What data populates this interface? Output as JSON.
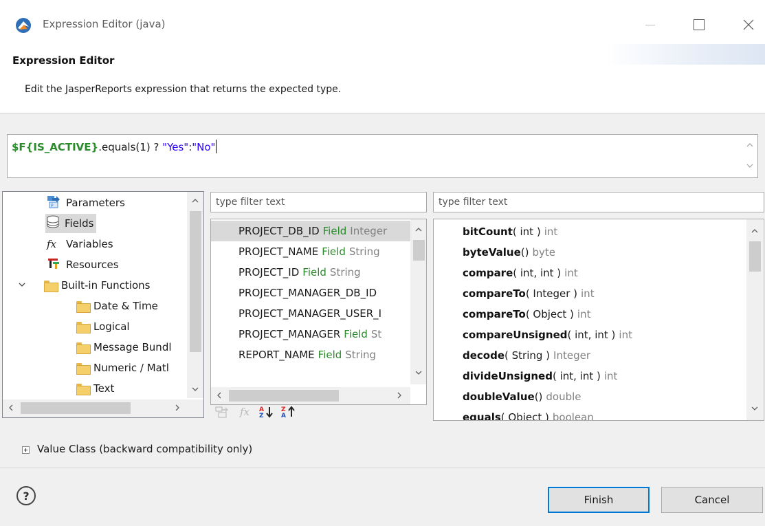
{
  "window": {
    "title": "Expression Editor (java)",
    "icon": "jaspersoft-bird-icon"
  },
  "header": {
    "title": "Expression Editor",
    "description": "Edit the JasperReports expression that returns the expected type."
  },
  "expression": {
    "part1": "$F{IS_ACTIVE}",
    "part2": ".equals(1) ? ",
    "part3": "\"Yes\"",
    "part4": ":",
    "part5": "\"No\""
  },
  "tree": {
    "items": [
      {
        "label": "Parameters",
        "icon": "parameters-icon"
      },
      {
        "label": "Fields",
        "icon": "database-icon",
        "selected": true
      },
      {
        "label": "Variables",
        "icon": "fx-icon"
      },
      {
        "label": "Resources",
        "icon": "resources-icon"
      },
      {
        "label": "Built-in Functions",
        "icon": "folder-icon",
        "expanded": true
      },
      {
        "label": "Date & Time",
        "icon": "folder-icon"
      },
      {
        "label": "Logical",
        "icon": "folder-icon"
      },
      {
        "label": "Message Bundl",
        "icon": "folder-icon"
      },
      {
        "label": "Numeric / Matl",
        "icon": "folder-icon"
      },
      {
        "label": "Text",
        "icon": "folder-icon"
      }
    ]
  },
  "fields_filter": {
    "placeholder": "type filter text"
  },
  "methods_filter": {
    "placeholder": "type filter text"
  },
  "fields": {
    "items": [
      {
        "name": "PROJECT_DB_ID",
        "kind": "Field",
        "type": "Integer"
      },
      {
        "name": "PROJECT_NAME",
        "kind": "Field",
        "type": "String"
      },
      {
        "name": "PROJECT_ID",
        "kind": "Field",
        "type": "String"
      },
      {
        "name": "PROJECT_MANAGER_DB_ID",
        "kind": "",
        "type": ""
      },
      {
        "name": "PROJECT_MANAGER_USER_I",
        "kind": "",
        "type": ""
      },
      {
        "name": "PROJECT_MANAGER",
        "kind": "Field",
        "type": "St"
      },
      {
        "name": "REPORT_NAME",
        "kind": "Field",
        "type": "String"
      }
    ]
  },
  "methods": {
    "items": [
      {
        "name": "bitCount",
        "args": "( int )",
        "ret": "int"
      },
      {
        "name": "byteValue",
        "args": "()",
        "ret": "byte"
      },
      {
        "name": "compare",
        "args": "( int, int )",
        "ret": "int"
      },
      {
        "name": "compareTo",
        "args": "( Integer )",
        "ret": "int"
      },
      {
        "name": "compareTo",
        "args": "( Object )",
        "ret": "int"
      },
      {
        "name": "compareUnsigned",
        "args": "( int, int )",
        "ret": "int"
      },
      {
        "name": "decode",
        "args": "( String )",
        "ret": "Integer"
      },
      {
        "name": "divideUnsigned",
        "args": "( int, int )",
        "ret": "int"
      },
      {
        "name": "doubleValue",
        "args": "()",
        "ret": "double"
      },
      {
        "name": "equals",
        "args": "( Object )",
        "ret": "boolean"
      }
    ]
  },
  "value_class": {
    "label": "Value Class (backward compatibility only)"
  },
  "buttons": {
    "finish": "Finish",
    "cancel": "Cancel",
    "help": "?"
  },
  "colors": {
    "field_keyword": "#2a8b2a",
    "string_literal": "#2a00ff",
    "type_gray": "#808080",
    "focus_border": "#0078d7"
  }
}
